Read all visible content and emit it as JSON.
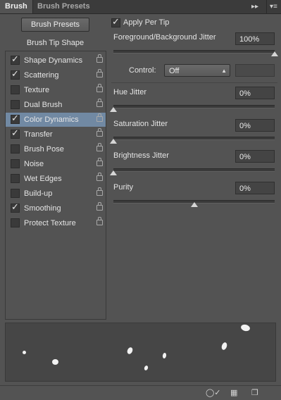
{
  "tabs": [
    {
      "label": "Brush",
      "active": true
    },
    {
      "label": "Brush Presets",
      "active": false
    }
  ],
  "panel_controls": {
    "collapse_icon": "double-chevron-right-icon",
    "menu_icon": "panel-menu-icon"
  },
  "left": {
    "presets_button": "Brush Presets",
    "tip_shape_label": "Brush Tip Shape",
    "options": [
      {
        "label": "Shape Dynamics",
        "checked": true,
        "selected": false
      },
      {
        "label": "Scattering",
        "checked": true,
        "selected": false
      },
      {
        "label": "Texture",
        "checked": false,
        "selected": false
      },
      {
        "label": "Dual Brush",
        "checked": false,
        "selected": false
      },
      {
        "label": "Color Dynamics",
        "checked": true,
        "selected": true
      },
      {
        "label": "Transfer",
        "checked": true,
        "selected": false
      },
      {
        "label": "Brush Pose",
        "checked": false,
        "selected": false
      },
      {
        "label": "Noise",
        "checked": false,
        "selected": false
      },
      {
        "label": "Wet Edges",
        "checked": false,
        "selected": false
      },
      {
        "label": "Build-up",
        "checked": false,
        "selected": false
      },
      {
        "label": "Smoothing",
        "checked": true,
        "selected": false
      },
      {
        "label": "Protect Texture",
        "checked": false,
        "selected": false
      }
    ]
  },
  "right": {
    "apply_per_tip": {
      "label": "Apply Per Tip",
      "checked": true
    },
    "fg_bg_jitter": {
      "label": "Foreground/Background Jitter",
      "value": "100%",
      "level": 1.0
    },
    "control": {
      "label": "Control:",
      "selected": "Off"
    },
    "hue_jitter": {
      "label": "Hue Jitter",
      "value": "0%",
      "level": 0.0
    },
    "saturation_jitter": {
      "label": "Saturation Jitter",
      "value": "0%",
      "level": 0.0
    },
    "brightness_jitter": {
      "label": "Brightness Jitter",
      "value": "0%",
      "level": 0.0
    },
    "purity": {
      "label": "Purity",
      "value": "0%",
      "level": 0.5
    }
  },
  "colors": {
    "panel_bg": "#535353",
    "selection": "#7189a3",
    "tab_bar": "#3b3b3b"
  },
  "bottom_icons": [
    "toggle-live-tip-preview-icon",
    "brush-grid-icon",
    "create-new-brush-icon"
  ]
}
